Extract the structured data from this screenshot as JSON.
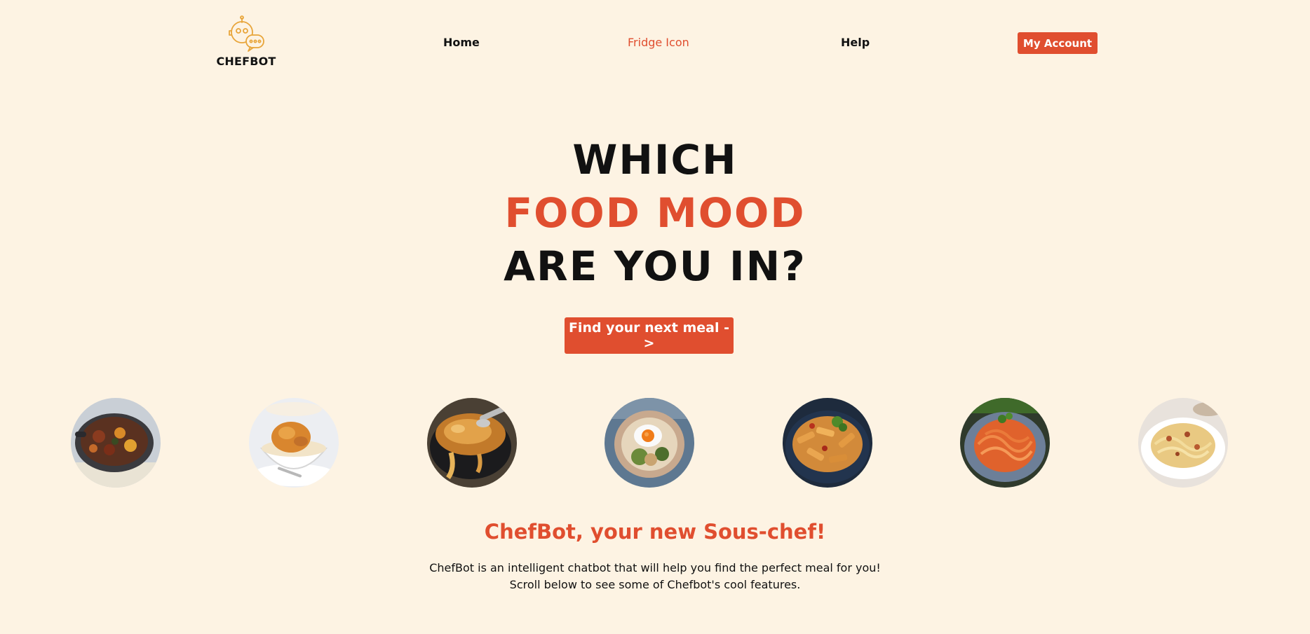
{
  "brand": {
    "name": "CHEFBOT",
    "logo_icon": "chef-robot-icon",
    "logo_color": "#e8a53a"
  },
  "nav": {
    "home": "Home",
    "fridge": "Fridge Icon",
    "help": "Help",
    "account": "My Account"
  },
  "hero": {
    "line1": "WHICH",
    "line2": "FOOD MOOD",
    "line3": "ARE YOU IN?",
    "cta": "Find your next meal ->"
  },
  "foods": [
    {
      "icon": "stew-pan-image"
    },
    {
      "icon": "cobbler-bowl-image"
    },
    {
      "icon": "onion-soup-image"
    },
    {
      "icon": "egg-rice-bowl-image"
    },
    {
      "icon": "penne-pasta-image"
    },
    {
      "icon": "spaghetti-image"
    },
    {
      "icon": "carbonara-image"
    }
  ],
  "intro": {
    "title": "ChefBot, your new Sous-chef!",
    "line1": "ChefBot is an intelligent chatbot that will help you find the perfect meal for you!",
    "line2": "Scroll below to see some of Chefbot's cool features."
  },
  "colors": {
    "background": "#fdf3e3",
    "accent": "#e04e2f",
    "text": "#111111"
  }
}
